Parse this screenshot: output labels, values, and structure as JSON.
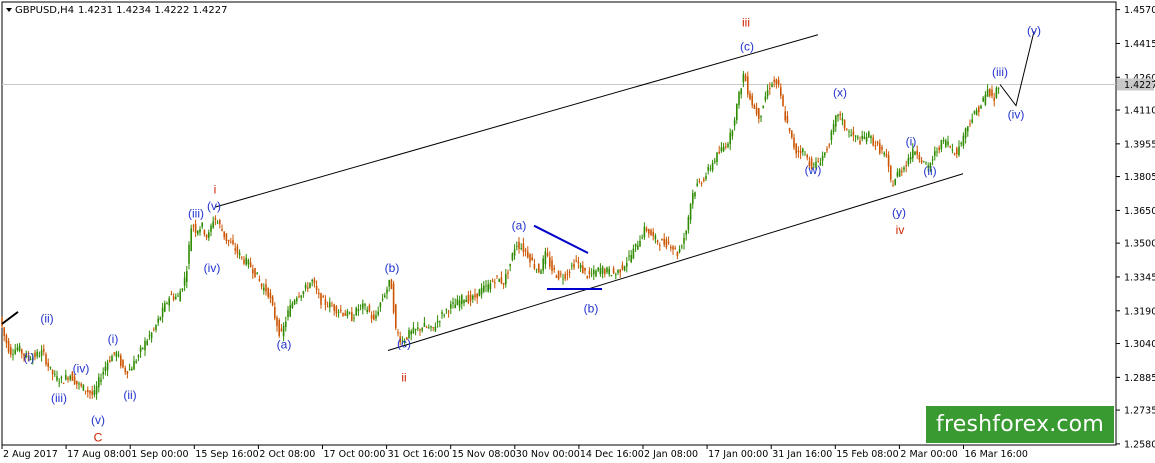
{
  "header": {
    "symbol_timeframe": "GBPUSD,H4",
    "ohlc": "1.4231 1.4234 1.4222 1.4227"
  },
  "watermark": {
    "text": "freshforex.com"
  },
  "chart_data": {
    "type": "candlestick",
    "ylim": [
      1.2575,
      1.4605
    ],
    "y_ticks": [
      "1.4570",
      "1.4415",
      "1.4260",
      "1.4110",
      "1.3955",
      "1.3805",
      "1.3650",
      "1.3500",
      "1.3345",
      "1.3190",
      "1.3040",
      "1.2885",
      "1.2735",
      "1.2580"
    ],
    "current_price": "1.4227",
    "x_ticks": [
      "2 Aug 2017",
      "17 Aug 08:00",
      "1 Sep 00:00",
      "15 Sep 16:00",
      "2 Oct 08:00",
      "17 Oct 00:00",
      "31 Oct 16:00",
      "15 Nov 08:00",
      "30 Nov 00:00",
      "14 Dec 16:00",
      "2 Jan 08:00",
      "17 Jan 00:00",
      "31 Jan 16:00",
      "15 Feb 08:00",
      "2 Mar 00:00",
      "16 Mar 16:00"
    ],
    "price_path": [
      [
        0,
        1.32
      ],
      [
        6,
        1.308
      ],
      [
        12,
        1.3
      ],
      [
        20,
        1.302
      ],
      [
        28,
        1.298
      ],
      [
        35,
        1.298
      ],
      [
        45,
        1.3
      ],
      [
        52,
        1.292
      ],
      [
        58,
        1.288
      ],
      [
        65,
        1.287
      ],
      [
        72,
        1.29
      ],
      [
        80,
        1.285
      ],
      [
        88,
        1.283
      ],
      [
        96,
        1.28
      ],
      [
        102,
        1.288
      ],
      [
        110,
        1.296
      ],
      [
        118,
        1.3
      ],
      [
        126,
        1.292
      ],
      [
        132,
        1.292
      ],
      [
        140,
        1.298
      ],
      [
        148,
        1.305
      ],
      [
        156,
        1.31
      ],
      [
        164,
        1.318
      ],
      [
        172,
        1.326
      ],
      [
        180,
        1.325
      ],
      [
        188,
        1.335
      ],
      [
        194,
        1.36
      ],
      [
        198,
        1.356
      ],
      [
        204,
        1.358
      ],
      [
        210,
        1.352
      ],
      [
        216,
        1.362
      ],
      [
        222,
        1.358
      ],
      [
        228,
        1.352
      ],
      [
        236,
        1.348
      ],
      [
        244,
        1.343
      ],
      [
        252,
        1.34
      ],
      [
        258,
        1.336
      ],
      [
        264,
        1.33
      ],
      [
        270,
        1.328
      ],
      [
        276,
        1.318
      ],
      [
        283,
        1.307
      ],
      [
        290,
        1.318
      ],
      [
        298,
        1.326
      ],
      [
        306,
        1.328
      ],
      [
        314,
        1.333
      ],
      [
        322,
        1.324
      ],
      [
        330,
        1.322
      ],
      [
        338,
        1.32
      ],
      [
        346,
        1.318
      ],
      [
        354,
        1.316
      ],
      [
        362,
        1.321
      ],
      [
        370,
        1.32
      ],
      [
        376,
        1.314
      ],
      [
        382,
        1.322
      ],
      [
        388,
        1.328
      ],
      [
        393,
        1.333
      ],
      [
        398,
        1.31
      ],
      [
        404,
        1.305
      ],
      [
        410,
        1.308
      ],
      [
        418,
        1.31
      ],
      [
        426,
        1.312
      ],
      [
        434,
        1.31
      ],
      [
        442,
        1.316
      ],
      [
        450,
        1.32
      ],
      [
        458,
        1.322
      ],
      [
        466,
        1.325
      ],
      [
        474,
        1.324
      ],
      [
        482,
        1.328
      ],
      [
        490,
        1.33
      ],
      [
        498,
        1.334
      ],
      [
        506,
        1.332
      ],
      [
        512,
        1.34
      ],
      [
        518,
        1.35
      ],
      [
        524,
        1.348
      ],
      [
        530,
        1.345
      ],
      [
        536,
        1.34
      ],
      [
        542,
        1.337
      ],
      [
        548,
        1.345
      ],
      [
        554,
        1.338
      ],
      [
        560,
        1.335
      ],
      [
        566,
        1.335
      ],
      [
        572,
        1.338
      ],
      [
        578,
        1.342
      ],
      [
        584,
        1.338
      ],
      [
        590,
        1.335
      ],
      [
        596,
        1.336
      ],
      [
        602,
        1.338
      ],
      [
        610,
        1.337
      ],
      [
        618,
        1.336
      ],
      [
        626,
        1.34
      ],
      [
        634,
        1.345
      ],
      [
        642,
        1.352
      ],
      [
        648,
        1.357
      ],
      [
        656,
        1.352
      ],
      [
        664,
        1.35
      ],
      [
        672,
        1.35
      ],
      [
        680,
        1.345
      ],
      [
        688,
        1.355
      ],
      [
        694,
        1.372
      ],
      [
        700,
        1.377
      ],
      [
        708,
        1.381
      ],
      [
        716,
        1.388
      ],
      [
        724,
        1.393
      ],
      [
        732,
        1.398
      ],
      [
        740,
        1.415
      ],
      [
        746,
        1.428
      ],
      [
        750,
        1.42
      ],
      [
        756,
        1.412
      ],
      [
        762,
        1.408
      ],
      [
        768,
        1.418
      ],
      [
        774,
        1.424
      ],
      [
        780,
        1.423
      ],
      [
        786,
        1.41
      ],
      [
        792,
        1.4
      ],
      [
        798,
        1.392
      ],
      [
        804,
        1.393
      ],
      [
        810,
        1.388
      ],
      [
        816,
        1.385
      ],
      [
        822,
        1.388
      ],
      [
        828,
        1.392
      ],
      [
        834,
        1.4
      ],
      [
        840,
        1.41
      ],
      [
        846,
        1.404
      ],
      [
        852,
        1.4
      ],
      [
        858,
        1.398
      ],
      [
        864,
        1.397
      ],
      [
        870,
        1.4
      ],
      [
        876,
        1.396
      ],
      [
        882,
        1.393
      ],
      [
        888,
        1.39
      ],
      [
        894,
        1.376
      ],
      [
        900,
        1.382
      ],
      [
        906,
        1.385
      ],
      [
        912,
        1.39
      ],
      [
        918,
        1.393
      ],
      [
        924,
        1.388
      ],
      [
        930,
        1.384
      ],
      [
        936,
        1.39
      ],
      [
        942,
        1.395
      ],
      [
        948,
        1.397
      ],
      [
        954,
        1.393
      ],
      [
        960,
        1.392
      ],
      [
        966,
        1.4
      ],
      [
        972,
        1.406
      ],
      [
        978,
        1.41
      ],
      [
        984,
        1.414
      ],
      [
        990,
        1.42
      ],
      [
        996,
        1.415
      ],
      [
        1000,
        1.423
      ]
    ],
    "trendlines": [
      {
        "from": [
          215,
          1.3665
        ],
        "to": [
          818,
          1.4455
        ],
        "color": "#000000"
      },
      {
        "from": [
          388,
          1.3008
        ],
        "to": [
          963,
          1.3818
        ],
        "color": "#000000"
      },
      {
        "from": [
          534,
          1.358
        ],
        "to": [
          588,
          1.3455
        ],
        "color": "#0000cc"
      },
      {
        "from": [
          547,
          1.329
        ],
        "to": [
          602,
          1.329
        ],
        "color": "#0000cc"
      }
    ],
    "projection": [
      [
        1000,
        1.4227
      ],
      [
        1016,
        1.413
      ],
      [
        1034,
        1.447
      ]
    ],
    "wave_labels": [
      {
        "text": "(i)",
        "x": 29,
        "y": 1.2975,
        "color": "#2233cc"
      },
      {
        "text": "(ii)",
        "x": 47,
        "y": 1.3155,
        "color": "#2233cc"
      },
      {
        "text": "(iii)",
        "x": 59,
        "y": 1.279,
        "color": "#2233cc"
      },
      {
        "text": "(iv)",
        "x": 81,
        "y": 1.2925,
        "color": "#2233cc"
      },
      {
        "text": "(v)",
        "x": 98,
        "y": 1.269,
        "color": "#2233cc"
      },
      {
        "text": "C",
        "x": 98,
        "y": 1.261,
        "color": "#cc2200"
      },
      {
        "text": "(i)",
        "x": 113,
        "y": 1.306,
        "color": "#2233cc"
      },
      {
        "text": "(ii)",
        "x": 130,
        "y": 1.2805,
        "color": "#2233cc"
      },
      {
        "text": "(iii)",
        "x": 196,
        "y": 1.3635,
        "color": "#2233cc"
      },
      {
        "text": "(iv)",
        "x": 212,
        "y": 1.3385,
        "color": "#2233cc"
      },
      {
        "text": "(v)",
        "x": 214,
        "y": 1.367,
        "color": "#2233cc"
      },
      {
        "text": "i",
        "x": 215,
        "y": 1.3745,
        "color": "#cc2200"
      },
      {
        "text": "(a)",
        "x": 284,
        "y": 1.3035,
        "color": "#2233cc"
      },
      {
        "text": "(b)",
        "x": 392,
        "y": 1.3385,
        "color": "#2233cc"
      },
      {
        "text": "(c)",
        "x": 404,
        "y": 1.304,
        "color": "#2233cc"
      },
      {
        "text": "ii",
        "x": 404,
        "y": 1.2885,
        "color": "#cc2200"
      },
      {
        "text": "(a)",
        "x": 519,
        "y": 1.358,
        "color": "#2233cc"
      },
      {
        "text": "(b)",
        "x": 591,
        "y": 1.32,
        "color": "#2233cc"
      },
      {
        "text": "iii",
        "x": 746,
        "y": 1.451,
        "color": "#cc2200"
      },
      {
        "text": "(c)",
        "x": 747,
        "y": 1.44,
        "color": "#2233cc"
      },
      {
        "text": "(w)",
        "x": 813,
        "y": 1.3835,
        "color": "#2233cc"
      },
      {
        "text": "(x)",
        "x": 840,
        "y": 1.419,
        "color": "#2233cc"
      },
      {
        "text": "(y)",
        "x": 899,
        "y": 1.364,
        "color": "#2233cc"
      },
      {
        "text": "iv",
        "x": 900,
        "y": 1.356,
        "color": "#cc2200"
      },
      {
        "text": "(i)",
        "x": 911,
        "y": 1.3965,
        "color": "#2233cc"
      },
      {
        "text": "(ii)",
        "x": 930,
        "y": 1.383,
        "color": "#2233cc"
      },
      {
        "text": "(iii)",
        "x": 1000,
        "y": 1.4285,
        "color": "#2233cc"
      },
      {
        "text": "(iv)",
        "x": 1016,
        "y": 1.409,
        "color": "#2233cc"
      },
      {
        "text": "(v)",
        "x": 1034,
        "y": 1.4475,
        "color": "#2233cc"
      }
    ],
    "colors": {
      "up": "#2e8b00",
      "down": "#cc5500",
      "wave_blue": "#2233cc",
      "wave_red": "#cc2200",
      "grid": "#c8c8c8"
    }
  }
}
